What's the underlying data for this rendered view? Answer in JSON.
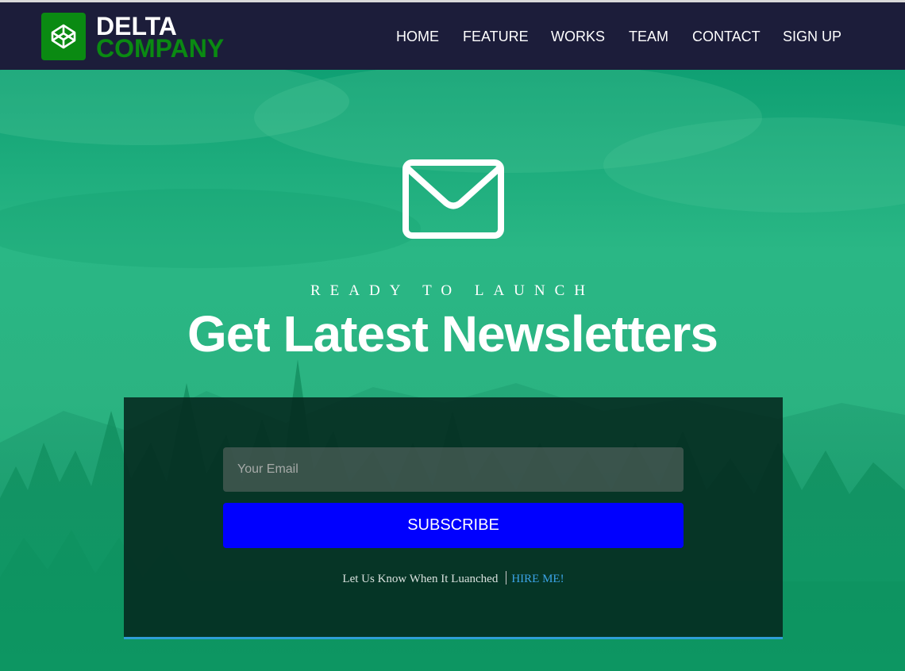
{
  "brand": {
    "name_line1": "DELTA",
    "name_line2": "COMPANY",
    "logo_color": "#0a8a12",
    "logo_icon": "codepen-cube-icon"
  },
  "nav": {
    "items": [
      {
        "label": "HOME"
      },
      {
        "label": "FEATURE"
      },
      {
        "label": "WORKS"
      },
      {
        "label": "TEAM"
      },
      {
        "label": "CONTACT"
      },
      {
        "label": "SIGN UP"
      }
    ]
  },
  "hero": {
    "icon": "envelope-icon",
    "eyebrow": "READY TO LAUNCH",
    "headline": "Get Latest Newsletters"
  },
  "form": {
    "email_placeholder": "Your Email",
    "email_value": "",
    "subscribe_label": "SUBSCRIBE",
    "launch_text": "Let Us Know When It Luanched",
    "hire_link": "HIRE ME!"
  },
  "colors": {
    "navbar_bg": "#1c1d3a",
    "hero_green": "#2ab785",
    "button_blue": "#0000ff",
    "link_blue": "#3ba3e6",
    "panel_border": "#2e9fd6"
  }
}
